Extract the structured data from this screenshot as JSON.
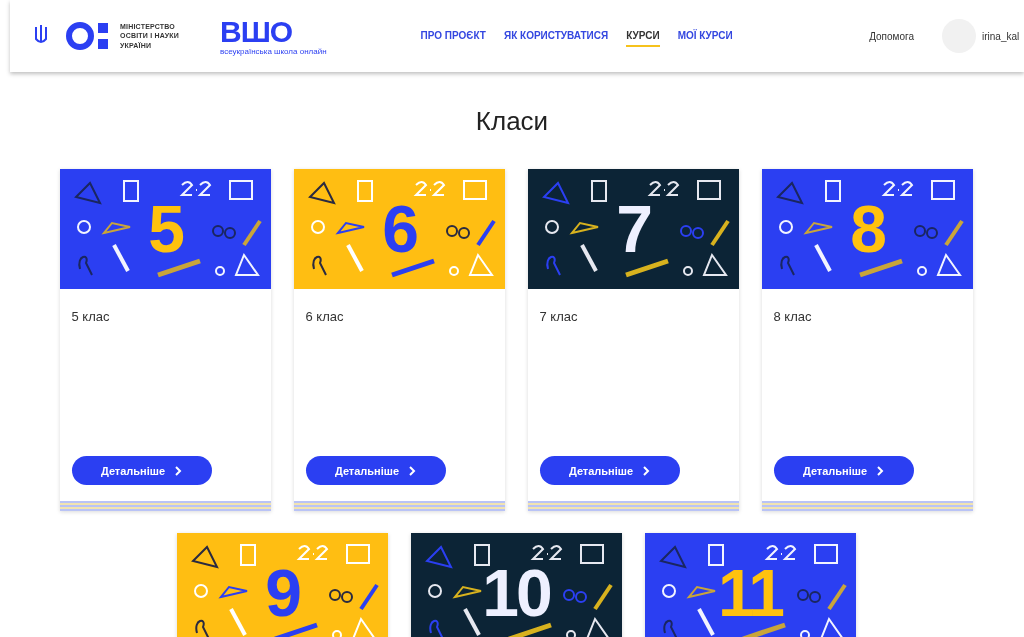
{
  "header": {
    "ministry_name": "МІНІСТЕРСТВО ОСВІТИ І НАУКИ УКРАЇНИ",
    "school_logo": "ВШО",
    "school_subtitle": "всеукраїнська школа онлайн",
    "nav": [
      {
        "label": "ПРО ПРОЄКТ",
        "selected": false
      },
      {
        "label": "ЯК КОРИСТУВАТИСЯ",
        "selected": false
      },
      {
        "label": "КУРСИ",
        "selected": true
      },
      {
        "label": "МОЇ КУРСИ",
        "selected": false
      }
    ],
    "help": "Допомога",
    "user": "irina_kal"
  },
  "title": "Класи",
  "rows": [
    [
      {
        "kind": "blue",
        "number": "5",
        "title": "5 клас",
        "button": "Детальніше"
      },
      {
        "kind": "yellow",
        "number": "6",
        "title": "6 клас",
        "button": "Детальніше"
      },
      {
        "kind": "navy",
        "number": "7",
        "title": "7 клас",
        "button": "Детальніше"
      },
      {
        "kind": "blue",
        "number": "8",
        "title": "8 клас",
        "button": "Детальніше"
      }
    ],
    [
      {
        "kind": "yellow",
        "number": "9"
      },
      {
        "kind": "navy",
        "number": "10"
      },
      {
        "kind": "blue",
        "number": "11"
      }
    ]
  ]
}
